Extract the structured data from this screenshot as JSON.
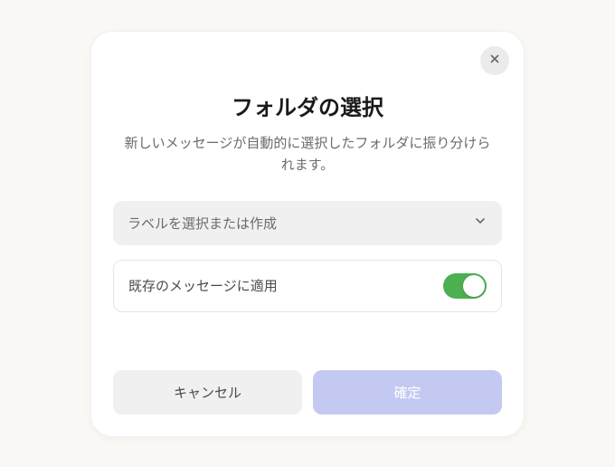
{
  "modal": {
    "title": "フォルダの選択",
    "subtitle": "新しいメッセージが自動的に選択したフォルダに振り分けられます。",
    "select_placeholder": "ラベルを選択または作成",
    "toggle_label": "既存のメッセージに適用",
    "toggle_on": true,
    "cancel_label": "キャンセル",
    "confirm_label": "確定"
  }
}
